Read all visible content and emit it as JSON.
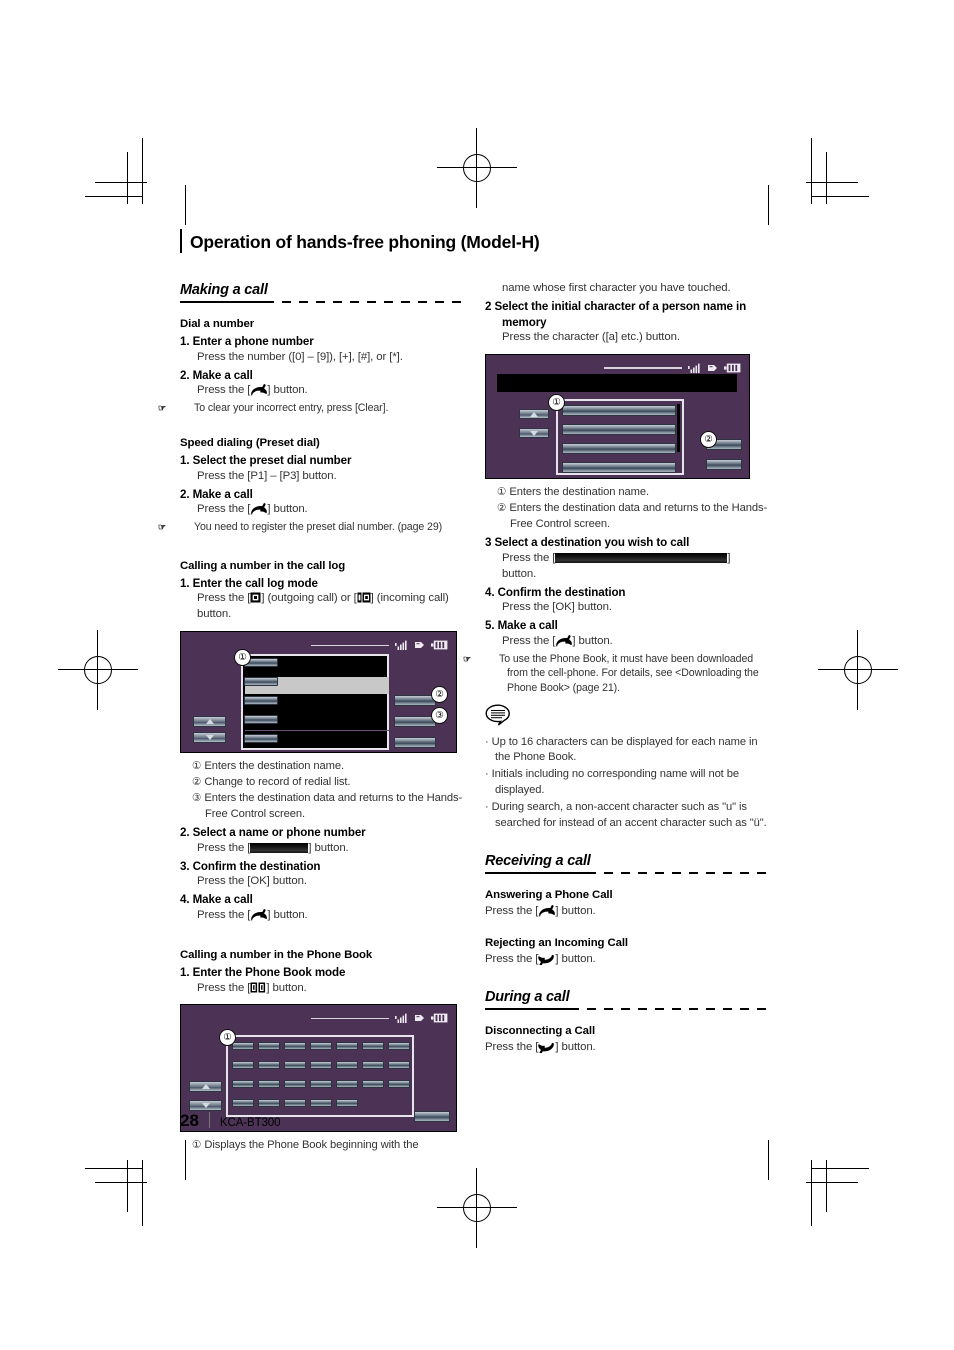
{
  "page": {
    "chapter_title": "Operation of hands-free phoning (Model-H)",
    "page_number": "28",
    "model": "KCA-BT300"
  },
  "left_column": {
    "section_title": "Making a call",
    "dial_a_number": {
      "heading": "Dial a number",
      "steps": [
        {
          "num": "1.",
          "label": "Enter a phone number",
          "detail_pre": "Press the number ([0] – [9]), [+], [#], or [*]."
        },
        {
          "num": "2.",
          "label": "Make a call",
          "detail_pre": "Press the [",
          "detail_post": "] button."
        }
      ],
      "note": "To clear your incorrect entry, press [Clear]."
    },
    "speed_dialing": {
      "heading": "Speed dialing (Preset dial)",
      "steps": [
        {
          "num": "1.",
          "label": "Select the preset dial number",
          "detail_pre": "Press the [P1] – [P3] button."
        },
        {
          "num": "2.",
          "label": "Make a call",
          "detail_pre": "Press the [",
          "detail_post": "] button."
        }
      ],
      "note": "You need to register the preset dial number. (page 29)"
    },
    "call_log": {
      "heading": "Calling a number in the call log",
      "step1_num": "1.",
      "step1_label": "Enter the call log mode",
      "step1_detail_a": "Press the [",
      "step1_detail_b": "] (outgoing call) or [",
      "step1_detail_c": "] (incoming call) button.",
      "callouts": [
        {
          "num": "①",
          "text": "Enters the destination name."
        },
        {
          "num": "②",
          "text": "Change to record of redial list."
        },
        {
          "num": "③",
          "text": "Enters the destination data and returns to the Hands-Free Control screen."
        }
      ],
      "steps": [
        {
          "num": "2.",
          "label": "Select a name or phone number",
          "detail_pre": "Press the [",
          "detail_post": "] button."
        },
        {
          "num": "3.",
          "label": "Confirm the destination",
          "detail_pre": "Press the [OK] button."
        },
        {
          "num": "4.",
          "label": "Make a call",
          "detail_pre": "Press the [",
          "detail_post": "] button."
        }
      ]
    },
    "phone_book": {
      "heading": "Calling a number in the Phone Book",
      "step1_num": "1.",
      "step1_label": "Enter the Phone Book mode",
      "step1_detail_pre": "Press the [",
      "step1_detail_post": "] button.",
      "callout": {
        "num": "①",
        "text": "Displays the Phone Book beginning with the"
      }
    }
  },
  "right_column": {
    "continued_text": "name whose first character you have touched.",
    "step2": {
      "num": "2",
      "label_line1": "Select the initial character of a person name in",
      "label_line2": "memory",
      "detail": "Press the character ([a] etc.) button."
    },
    "callouts": [
      {
        "num": "①",
        "text": "Enters the destination name."
      },
      {
        "num": "②",
        "text": "Enters the destination data and returns to the Hands-Free Control screen."
      }
    ],
    "step3": {
      "num": "3",
      "label": "Select a destination you wish to call",
      "detail_pre": "Press the [",
      "detail_post": "]",
      "detail_line2": "button."
    },
    "step4": {
      "num": "4.",
      "label": "Confirm the destination",
      "detail": "Press the [OK] button."
    },
    "step5": {
      "num": "5.",
      "label": "Make a call",
      "detail_pre": "Press the [",
      "detail_post": "] button."
    },
    "note": "To use the Phone Book, it must have been downloaded from the cell-phone. For details, see <Downloading the Phone Book> (page 21).",
    "memo_bullets": [
      "Up to 16 characters can be displayed for each name in the Phone Book.",
      "Initials including no corresponding name will not be displayed.",
      "During search, a non-accent character such as \"u\" is searched for instead of an accent character such as \"ü\"."
    ],
    "receiving_a_call": {
      "section_title": "Receiving a call",
      "answering": {
        "heading": "Answering a Phone Call",
        "detail_pre": "Press the [",
        "detail_post": "] button."
      },
      "rejecting": {
        "heading": "Rejecting an Incoming Call",
        "detail_pre": "Press the [",
        "detail_post": "] button."
      }
    },
    "during_a_call": {
      "section_title": "During a call",
      "disconnecting": {
        "heading": "Disconnecting a Call",
        "detail_pre": "Press the [",
        "detail_post": "] button."
      }
    }
  },
  "screenshots": {
    "call_log": {
      "name": "call-log-screen",
      "badges": [
        "①",
        "②",
        "③"
      ],
      "status_icons": [
        "signal-bars-icon",
        "bluetooth-icon",
        "battery-icon"
      ]
    },
    "phone_book_index": {
      "name": "phone-book-index-screen",
      "badges": [
        "①"
      ],
      "status_icons": [
        "signal-bars-icon",
        "bluetooth-icon",
        "battery-icon"
      ],
      "grid_columns": 7,
      "grid_rows": 4,
      "last_row_keys": 5
    },
    "destination_list": {
      "name": "destination-list-screen",
      "badges": [
        "①",
        "②"
      ],
      "status_icons": [
        "signal-bars-icon",
        "bluetooth-icon",
        "battery-icon"
      ]
    }
  },
  "colors": {
    "screen_background": "#4c3355",
    "screen_black": "#000000",
    "key_highlight": "#c8c8c8",
    "text": "#000000",
    "body_text": "#333333"
  }
}
